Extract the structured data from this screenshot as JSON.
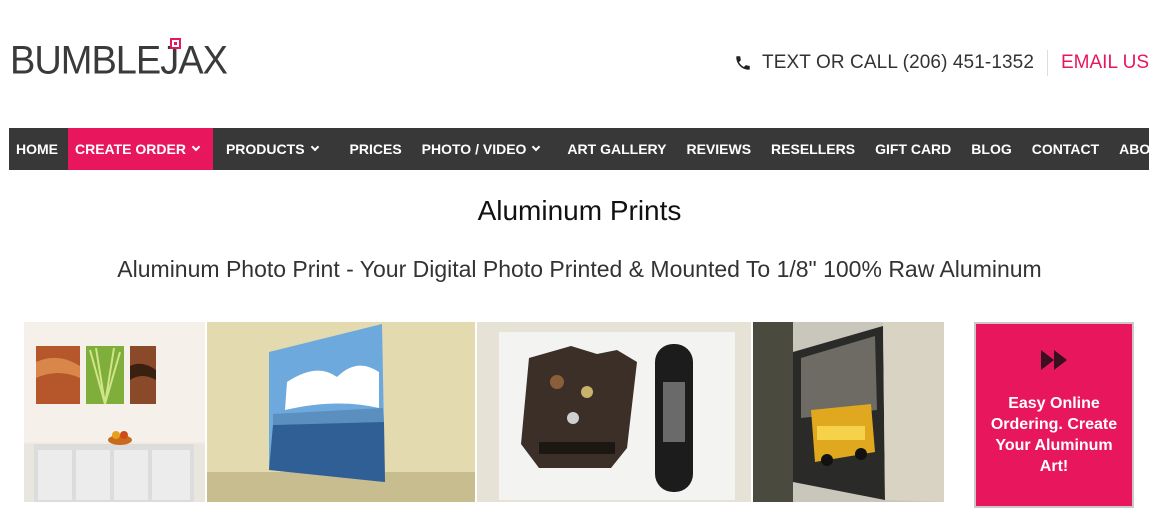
{
  "brand": {
    "logo_text": "BUMBLEJAX",
    "accent": "#e8175d"
  },
  "header": {
    "phone_label": "TEXT OR CALL (206) 451-1352",
    "email_label": "EMAIL US",
    "phone_icon": "phone-icon"
  },
  "nav": {
    "items": [
      {
        "label": "HOME",
        "dropdown": false
      },
      {
        "label": "CREATE ORDER",
        "dropdown": true,
        "active": true
      },
      {
        "label": "PRODUCTS",
        "dropdown": true
      },
      {
        "label": "PRICES",
        "dropdown": false
      },
      {
        "label": "PHOTO / VIDEO",
        "dropdown": true
      },
      {
        "label": "ART GALLERY",
        "dropdown": false
      },
      {
        "label": "REVIEWS",
        "dropdown": false
      },
      {
        "label": "RESELLERS",
        "dropdown": false
      },
      {
        "label": "GIFT CARD",
        "dropdown": false
      },
      {
        "label": "BLOG",
        "dropdown": false
      },
      {
        "label": "CONTACT",
        "dropdown": false
      },
      {
        "label": "ABOUT",
        "dropdown": false
      }
    ]
  },
  "main": {
    "title": "Aluminum Prints",
    "subtitle": "Aluminum Photo Print - Your Digital Photo Printed & Mounted To 1/8\" 100% Raw Aluminum"
  },
  "cta": {
    "icon": "fast-forward-icon",
    "text": "Easy Online Ordering. Create Your Aluminum Art!"
  }
}
